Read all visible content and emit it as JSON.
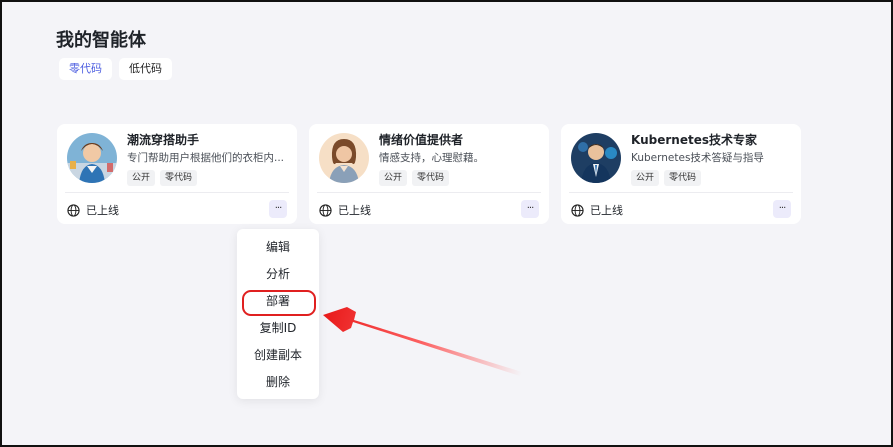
{
  "page": {
    "title": "我的智能体"
  },
  "tabs": [
    {
      "label": "零代码",
      "active": true
    },
    {
      "label": "低代码",
      "active": false
    }
  ],
  "cards": [
    {
      "name": "潮流穿搭助手",
      "description": "专门帮助用户根据他们的衣柜内...",
      "tags": [
        "公开",
        "零代码"
      ],
      "status": "已上线",
      "more": "···"
    },
    {
      "name": "情绪价值提供者",
      "description": "情感支持，心理慰藉。",
      "tags": [
        "公开",
        "零代码"
      ],
      "status": "已上线",
      "more": "···"
    },
    {
      "name": "Kubernetes技术专家",
      "description": "Kubernetes技术答疑与指导",
      "tags": [
        "公开",
        "零代码"
      ],
      "status": "已上线",
      "more": "···"
    }
  ],
  "context_menu": {
    "items": [
      "编辑",
      "分析",
      "部署",
      "复制ID",
      "创建副本",
      "删除"
    ],
    "highlighted": "部署"
  },
  "colors": {
    "accent": "#4e5fe0",
    "annotation": "#e02020",
    "background": "#f4f4f8"
  },
  "icons": {
    "status": "globe-icon",
    "more": "more-horizontal-icon"
  }
}
